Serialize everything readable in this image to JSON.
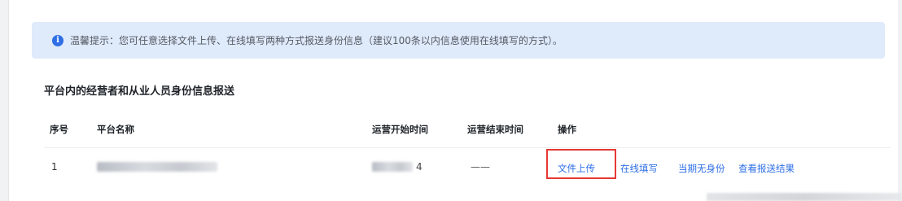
{
  "notice": {
    "icon": "info-icon",
    "text": "温馨提示：您可任意选择文件上传、在线填写两种方式报送身份信息（建议100条以内信息使用在线填写的方式）。"
  },
  "section": {
    "title": "平台内的经营者和从业人员身份信息报送"
  },
  "table": {
    "headers": {
      "index": "序号",
      "platform_name": "平台名称",
      "start_time": "运营开始时间",
      "end_time": "运营结束时间",
      "actions": "操作"
    },
    "rows": [
      {
        "index": "1",
        "platform_name_redacted": true,
        "start_time_suffix": "4",
        "end_time": "——"
      }
    ],
    "actions": {
      "file_upload": "文件上传",
      "online_fill": "在线填写",
      "no_identity": "当期无身份",
      "view_result": "查看报送结果"
    }
  },
  "colors": {
    "accent": "#2f6fe6",
    "notice_bg": "#dfeafb",
    "highlight_border": "#e53935"
  }
}
